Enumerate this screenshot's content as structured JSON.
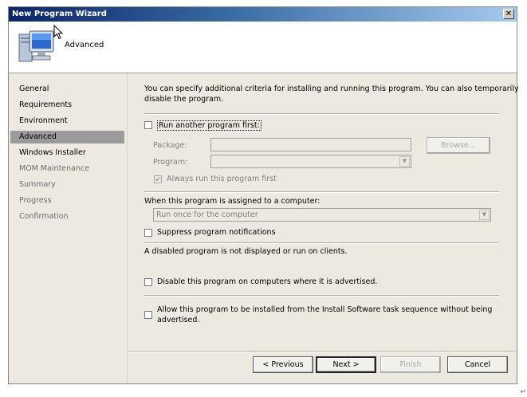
{
  "window": {
    "title": "New Program Wizard",
    "close_glyph": "✕"
  },
  "header": {
    "step_title": "Advanced",
    "icon": "computer-icon"
  },
  "sidebar": {
    "items": [
      {
        "label": "General",
        "state": "done"
      },
      {
        "label": "Requirements",
        "state": "done"
      },
      {
        "label": "Environment",
        "state": "done"
      },
      {
        "label": "Advanced",
        "state": "active"
      },
      {
        "label": "Windows Installer",
        "state": "next"
      },
      {
        "label": "MOM Maintenance",
        "state": "pending"
      },
      {
        "label": "Summary",
        "state": "pending"
      },
      {
        "label": "Progress",
        "state": "pending"
      },
      {
        "label": "Confirmation",
        "state": "pending"
      }
    ]
  },
  "main": {
    "intro_line1": "You can specify additional criteria for installing and running this program. You can also temporarily",
    "intro_line2": "disable the program.",
    "run_another": {
      "label": "Run another program first:",
      "checked": false
    },
    "package": {
      "label": "Package:",
      "value": ""
    },
    "browse_label": "Browse...",
    "program": {
      "label": "Program:",
      "value": ""
    },
    "always_run": {
      "label": "Always run this program first",
      "checked": true,
      "enabled": false
    },
    "assigned_label": "When this program is assigned to a computer:",
    "assigned_value": "Run once for the computer",
    "suppress": {
      "label": "Suppress program notifications",
      "checked": false
    },
    "disabled_note": "A disabled program is not displayed or run on clients.",
    "disable": {
      "label": "Disable this program on computers where it is advertised.",
      "checked": false
    },
    "allow_line1": "Allow this program to be installed from the Install Software task sequence without being",
    "allow_line2": "advertised.",
    "allow_checked": false
  },
  "footer": {
    "previous": "< Previous",
    "next": "Next >",
    "finish": "Finish",
    "cancel": "Cancel"
  },
  "colors": {
    "titlebar_start": "#0a246a",
    "titlebar_end": "#a6caf0",
    "active_nav": "#9b9b9b",
    "dialog_bg": "#ece9e0"
  }
}
